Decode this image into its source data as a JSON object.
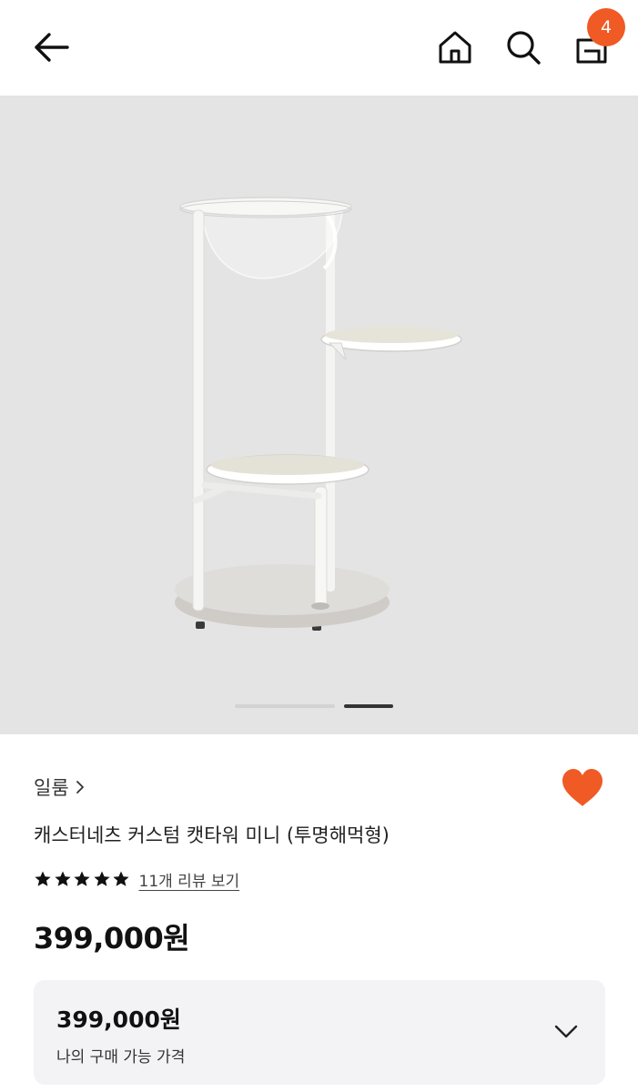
{
  "header": {
    "back_icon": "arrow-left-icon",
    "home_icon": "home-icon",
    "search_icon": "search-icon",
    "cart_icon": "shopping-bag-icon",
    "cart_count": "4",
    "badge_color": "#f05a24"
  },
  "gallery": {
    "product_image": "white cat tower with three round shelves and clear bowl",
    "slide_count": 2,
    "active_slide": 2
  },
  "product": {
    "brand": "일룸",
    "title": "캐스터네츠 커스텀 캣타워 미니 (투명해먹형)",
    "rating": 5,
    "review_link": "11개 리뷰 보기",
    "price": "399,000원",
    "wishlisted": true,
    "heart_color": "#f05a24"
  },
  "price_box": {
    "price": "399,000원",
    "label": "나의 구매 가능 가격",
    "chevron_icon": "chevron-down-icon"
  }
}
